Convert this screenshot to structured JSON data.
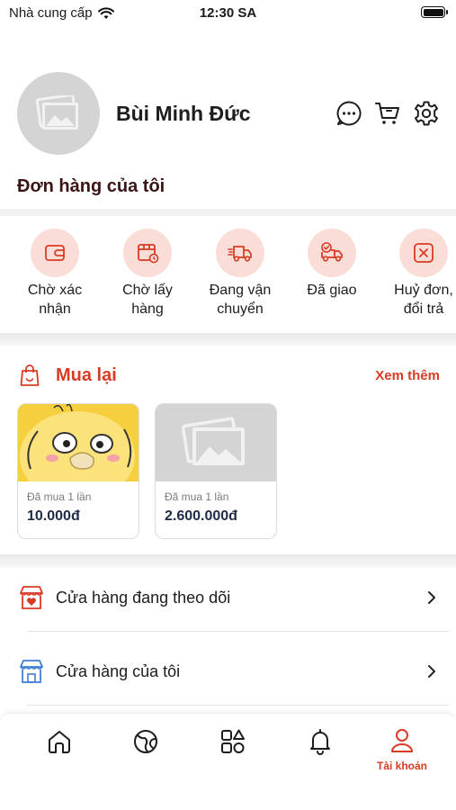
{
  "status_bar": {
    "carrier": "Nhà cung cấp",
    "time": "12:30 SA"
  },
  "profile": {
    "name": "Bùi Minh Đức"
  },
  "orders": {
    "title": "Đơn hàng của tôi",
    "statuses": [
      {
        "label_line1": "Chờ xác",
        "label_line2": "nhận",
        "icon": "wallet-icon"
      },
      {
        "label_line1": "Chờ lấy",
        "label_line2": "hàng",
        "icon": "box-clock-icon"
      },
      {
        "label_line1": "Đang vận",
        "label_line2": "chuyển",
        "icon": "delivery-truck-icon"
      },
      {
        "label_line1": "Đã giao",
        "label_line2": "",
        "icon": "delivered-truck-icon"
      },
      {
        "label_line1": "Huỷ đơn,",
        "label_line2": "đổi trả",
        "icon": "cancel-icon"
      }
    ]
  },
  "buy_again": {
    "title": "Mua lại",
    "more": "Xem thêm",
    "products": [
      {
        "bought": "Đã mua 1 lần",
        "price": "10.000đ"
      },
      {
        "bought": "Đã mua 1 lần",
        "price": "2.600.000đ"
      }
    ]
  },
  "menu": [
    {
      "label": "Cửa hàng đang theo dõi",
      "icon": "store-heart-icon"
    },
    {
      "label": "Cửa hàng của tôi",
      "icon": "store-icon"
    }
  ],
  "tabbar": {
    "active_label": "Tài khoản"
  },
  "colors": {
    "accent": "#d83b24",
    "icon_bg": "#f9ddd6",
    "store_blue": "#3f7fd6"
  }
}
